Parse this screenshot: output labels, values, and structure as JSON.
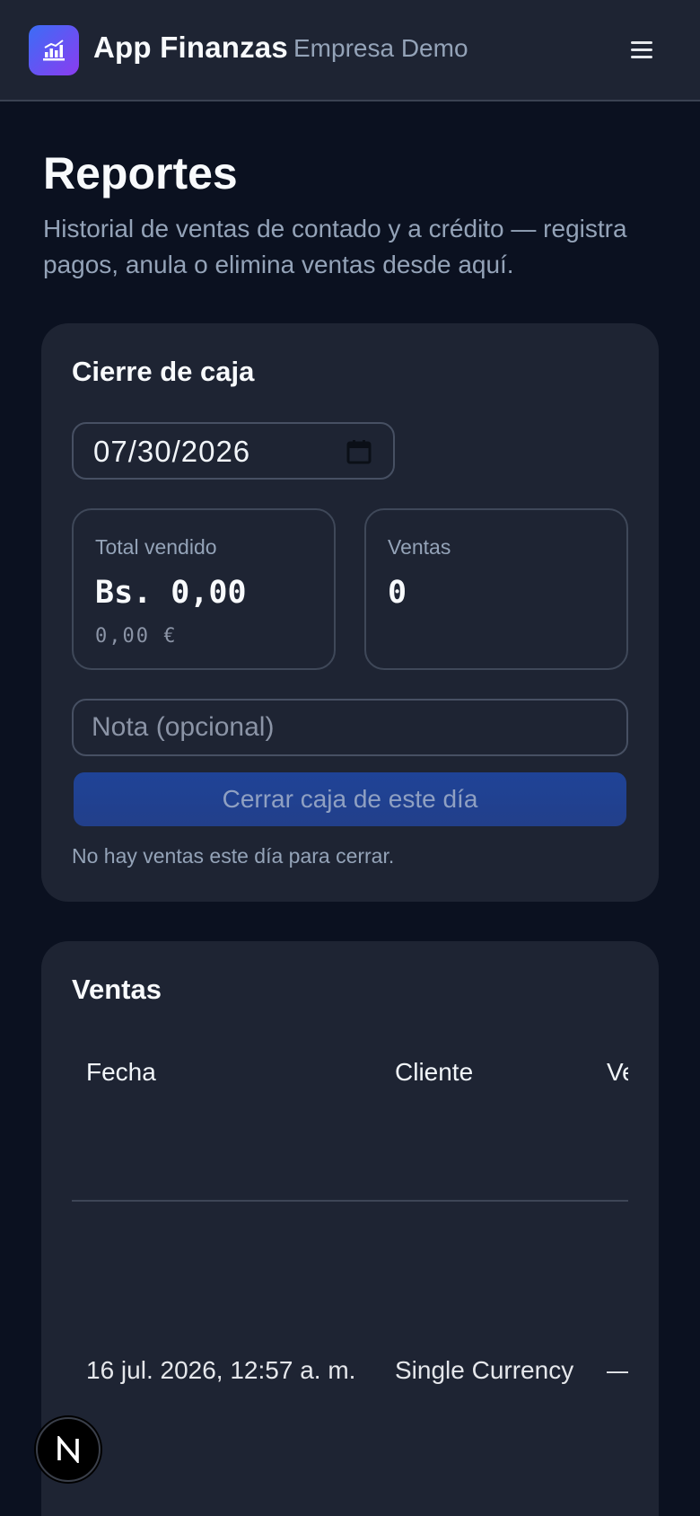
{
  "header": {
    "app_title": "App Finanzas",
    "company": "Empresa Demo",
    "logo_icon": "bar-chart-icon",
    "menu_icon": "hamburger-menu-icon"
  },
  "page": {
    "title": "Reportes",
    "description": "Historial de ventas de contado y a crédito — registra pagos, anula o elimina ventas desde aquí."
  },
  "cash_close": {
    "title": "Cierre de caja",
    "date_value": "07/30/2026",
    "total_label": "Total vendido",
    "total_value": "Bs. 0,00",
    "total_sub": "0,00 €",
    "sales_label": "Ventas",
    "sales_value": "0",
    "note_placeholder": "Nota (opcional)",
    "button_label": "Cerrar caja de este día",
    "info": "No hay ventas este día para cerrar."
  },
  "sales": {
    "title": "Ventas",
    "columns": [
      "Fecha",
      "Cliente",
      "Ve"
    ],
    "rows": [
      {
        "fecha": "16 jul. 2026, 12:57 a. m.",
        "cliente": "Single Currency",
        "ve": "—"
      }
    ]
  },
  "badge": {
    "letter": "N"
  },
  "colors": {
    "background": "#0b1120",
    "card": "#1e2433",
    "accent_gradient_start": "#3b6df6",
    "accent_gradient_end": "#8b3cf0",
    "button": "#1f4397",
    "muted_text": "#94a3b8"
  }
}
